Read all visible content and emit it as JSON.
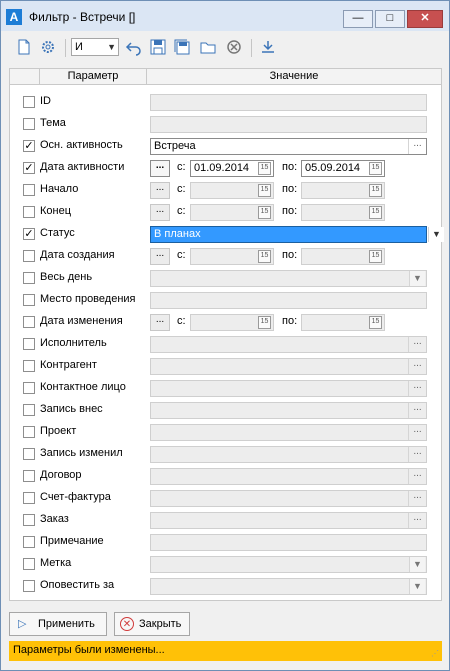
{
  "window": {
    "icon_letter": "A",
    "title": "Фильтр - Встречи []",
    "min": "—",
    "max": "□",
    "close": "✕"
  },
  "toolbar": {
    "operator_value": "И",
    "icons": [
      "new-document-icon",
      "settings-gear-icon",
      "undo-icon",
      "save-icon",
      "save-all-icon",
      "folder-icon",
      "cancel-icon",
      "import-icon"
    ]
  },
  "grid": {
    "col_param": "Параметр",
    "col_value": "Значение",
    "from_label": "с:",
    "to_label": "по:",
    "ellipsis": "...",
    "rows": [
      {
        "label": "ID",
        "checked": false,
        "type": "text"
      },
      {
        "label": "Тема",
        "checked": false,
        "type": "text"
      },
      {
        "label": "Осн. активность",
        "checked": true,
        "type": "lookup",
        "value": "Встреча"
      },
      {
        "label": "Дата активности",
        "checked": true,
        "type": "daterange",
        "from": "01.09.2014",
        "to": "05.09.2014"
      },
      {
        "label": "Начало",
        "checked": false,
        "type": "daterange",
        "from": "",
        "to": ""
      },
      {
        "label": "Конец",
        "checked": false,
        "type": "daterange",
        "from": "",
        "to": ""
      },
      {
        "label": "Статус",
        "checked": true,
        "type": "dropdown",
        "value": "В планах",
        "selected": true
      },
      {
        "label": "Дата создания",
        "checked": false,
        "type": "daterange",
        "from": "",
        "to": ""
      },
      {
        "label": "Весь день",
        "checked": false,
        "type": "dropdown",
        "value": ""
      },
      {
        "label": "Место проведения",
        "checked": false,
        "type": "text"
      },
      {
        "label": "Дата изменения",
        "checked": false,
        "type": "daterange",
        "from": "",
        "to": ""
      },
      {
        "label": "Исполнитель",
        "checked": false,
        "type": "lookup"
      },
      {
        "label": "Контрагент",
        "checked": false,
        "type": "lookup"
      },
      {
        "label": "Контактное лицо",
        "checked": false,
        "type": "lookup"
      },
      {
        "label": "Запись внес",
        "checked": false,
        "type": "lookup"
      },
      {
        "label": "Проект",
        "checked": false,
        "type": "lookup"
      },
      {
        "label": "Запись изменил",
        "checked": false,
        "type": "lookup"
      },
      {
        "label": "Договор",
        "checked": false,
        "type": "lookup"
      },
      {
        "label": "Счет-фактура",
        "checked": false,
        "type": "lookup"
      },
      {
        "label": "Заказ",
        "checked": false,
        "type": "lookup"
      },
      {
        "label": "Примечание",
        "checked": false,
        "type": "text"
      },
      {
        "label": "Метка",
        "checked": false,
        "type": "dropdown",
        "value": ""
      },
      {
        "label": "Оповестить за",
        "checked": false,
        "type": "dropdown",
        "value": ""
      }
    ]
  },
  "buttons": {
    "apply": "Применить",
    "close": "Закрыть"
  },
  "status": {
    "text": "Параметры были изменены...",
    "color": "#ffc107"
  }
}
